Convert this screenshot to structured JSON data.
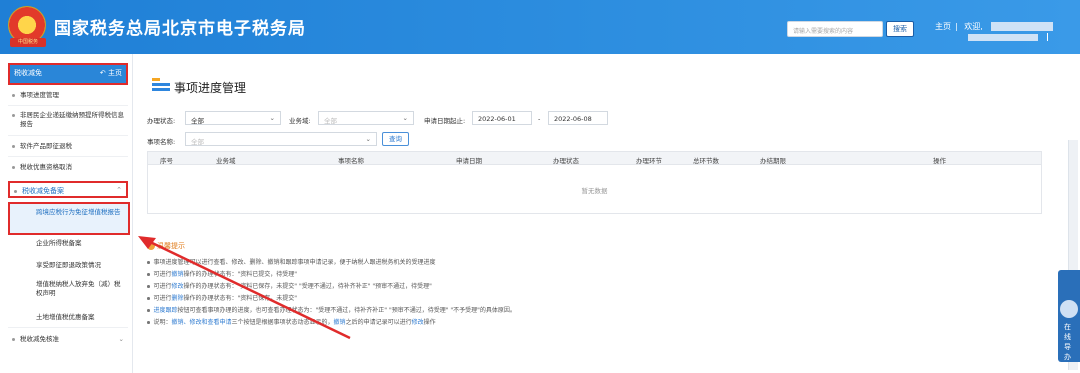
{
  "header": {
    "title": "国家税务总局北京市电子税务局",
    "emblem_text": "中国税务",
    "search_placeholder": "请输入需要搜索的内容",
    "search_button": "搜索",
    "home_link": "主页",
    "welcome": "欢迎,",
    "logout": "退出"
  },
  "sidebar": {
    "head_label": "税收减免",
    "home_label": "主页",
    "items": [
      {
        "label": "事项进度管理"
      },
      {
        "label": "非居民企业递延缴纳预提所得税信息报告"
      },
      {
        "label": "软件产品即征退税"
      },
      {
        "label": "税收优惠资格取消"
      }
    ],
    "group_label": "税收减免备案",
    "sub_items": [
      {
        "label": "跨境应税行为免征增值税报告"
      },
      {
        "label": "企业所得税备案"
      },
      {
        "label": "享受即征即退政策情况"
      },
      {
        "label": "增值税纳税人放弃免（减）税权声明"
      },
      {
        "label": "土地增值税优惠备案"
      }
    ],
    "last_item": "税收减免核准"
  },
  "main": {
    "title": "事项进度管理",
    "filters": {
      "status_label": "办理状态:",
      "status_value": "全部",
      "biz_label": "业务域:",
      "biz_value": "全部",
      "date_label": "申请日期起止:",
      "date_start": "2022-06-01",
      "date_sep": "-",
      "date_end": "2022-06-08",
      "name_label": "事项名称:",
      "name_value": "全部",
      "query_button": "查询"
    },
    "table": {
      "columns": [
        "序号",
        "业务域",
        "事项名称",
        "申请日期",
        "办理状态",
        "办理环节",
        "总环节数",
        "办结期限",
        "操作"
      ],
      "empty_text": "暂无数据"
    },
    "tips": {
      "title": "温馨提示",
      "lines": [
        [
          "事项进度管理可以进行查看、修改、删除、撤销和跟踪事项申请记录，便于纳税人跟进税务机关的受理进度"
        ],
        [
          "可进行",
          "撤销",
          "操作的办理状态有：\"资料已提交，待受理\""
        ],
        [
          "可进行",
          "修改",
          "操作的办理状态有：\"资料已保存，未提交\"  \"受理不通过，待补齐补正\"  \"预审不通过，待受理\""
        ],
        [
          "可进行",
          "删除",
          "操作的办理状态有：\"资料已保存，未提交\""
        ],
        [
          "",
          "进度跟踪",
          "按钮可查看事项办理的进度，也可查看办理状态为：\"受理不通过，待补齐补正\"  \"预审不通过，待受理\"  \"不予受理\"的具体原因。"
        ],
        [
          "说明：",
          "撤销、修改和查看申请",
          "三个按钮是根据事项状态动态显示的，",
          "撤销",
          "之后的申请记录可以进行",
          "修改",
          "操作"
        ]
      ]
    }
  },
  "float": {
    "label": "在线导办"
  },
  "colors": {
    "header_blue": "#2e8fe0",
    "highlight_red": "#e02b2b",
    "link_blue": "#2d7ad0",
    "tips_orange": "#e07b1a"
  }
}
